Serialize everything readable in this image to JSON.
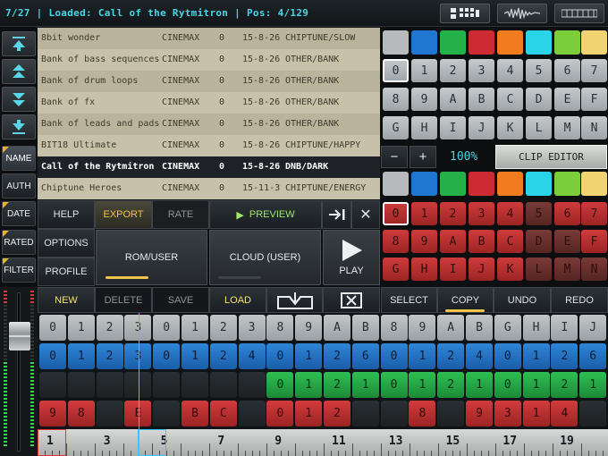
{
  "status": "7/27 | Loaded: Call of the Rytmitron | Pos: 4/129",
  "top_buttons": [
    "pattern-matrix-icon",
    "waveform-icon",
    "keyboard-icon"
  ],
  "sidebar": {
    "nav": [
      "scroll-top-icon",
      "page-up-icon",
      "page-down-icon",
      "scroll-bottom-icon"
    ],
    "sort": [
      "NAME",
      "AUTH",
      "DATE",
      "RATED",
      "FILTER"
    ]
  },
  "songs": [
    {
      "name": "8bit wonder",
      "author": "CINEMAX",
      "rating": "0",
      "date": "15-8-26",
      "genre": "CHIPTUNE/SLOW"
    },
    {
      "name": "Bank of bass sequences",
      "author": "CINEMAX",
      "rating": "0",
      "date": "15-8-26",
      "genre": "OTHER/BANK"
    },
    {
      "name": "Bank of drum loops",
      "author": "CINEMAX",
      "rating": "0",
      "date": "15-8-26",
      "genre": "OTHER/BANK"
    },
    {
      "name": "Bank of fx",
      "author": "CINEMAX",
      "rating": "0",
      "date": "15-8-26",
      "genre": "OTHER/BANK"
    },
    {
      "name": "Bank of leads and pads",
      "author": "CINEMAX",
      "rating": "0",
      "date": "15-8-26",
      "genre": "OTHER/BANK"
    },
    {
      "name": "BIT18 Ultimate",
      "author": "CINEMAX",
      "rating": "0",
      "date": "15-8-26",
      "genre": "CHIPTUNE/HAPPY"
    },
    {
      "name": "Call of the Rytmitron",
      "author": "CINEMAX",
      "rating": "0",
      "date": "15-8-26",
      "genre": "DNB/DARK"
    },
    {
      "name": "Chiptune Heroes",
      "author": "CINEMAX",
      "rating": "0",
      "date": "15-11-3",
      "genre": "CHIPTUNE/ENERGY"
    }
  ],
  "selected_song": 6,
  "controls": {
    "help": "HELP",
    "export": "EXPORT",
    "rate": "RATE",
    "preview": "PREVIEW",
    "options": "OPTIONS",
    "profile": "PROFILE",
    "rom_user": "ROM/USER",
    "cloud_user": "CLOUD (USER)",
    "play": "PLAY",
    "new": "NEW",
    "delete": "DELETE",
    "save": "SAVE",
    "load": "LOAD"
  },
  "edit_buttons": [
    "SELECT",
    "COPY",
    "UNDO",
    "REDO"
  ],
  "colors": {
    "swatches": [
      "#b6babd",
      "#1f77d2",
      "#24b14a",
      "#cc2b34",
      "#f07c1e",
      "#29d4e8",
      "#7ccd3a",
      "#f1d471"
    ],
    "cyan": "#49d6e6",
    "gold": "#f0c34a"
  },
  "pattern_pads": [
    "0",
    "1",
    "2",
    "3",
    "4",
    "5",
    "6",
    "7",
    "8",
    "9",
    "A",
    "B",
    "C",
    "D",
    "E",
    "F",
    "G",
    "H",
    "I",
    "J",
    "K",
    "L",
    "M",
    "N"
  ],
  "zoom": "100%",
  "clip_editor": "CLIP EDITOR",
  "minus": "−",
  "plus": "+",
  "clip_pads": [
    "0",
    "1",
    "2",
    "3",
    "4",
    "5",
    "6",
    "7",
    "8",
    "9",
    "A",
    "B",
    "C",
    "D",
    "E",
    "F",
    "G",
    "H",
    "I",
    "J",
    "K",
    "L",
    "M",
    "N"
  ],
  "sequencer_tracks": [
    {
      "color": "g",
      "cells": [
        "0",
        "1",
        "2",
        "3",
        "0",
        "1",
        "2",
        "3",
        "8",
        "9",
        "A",
        "B",
        "8",
        "9",
        "A",
        "B",
        "G",
        "H",
        "I",
        "J"
      ]
    },
    {
      "color": "b",
      "cells": [
        "0",
        "1",
        "2",
        "3",
        "0",
        "1",
        "2",
        "4",
        "0",
        "1",
        "2",
        "6",
        "0",
        "1",
        "2",
        "4",
        "0",
        "1",
        "2",
        "6"
      ]
    },
    {
      "color": "gr",
      "cells": [
        "",
        "",
        "",
        "",
        "",
        "",
        "",
        "",
        "0",
        "1",
        "2",
        "1",
        "0",
        "1",
        "2",
        "1",
        "0",
        "1",
        "2",
        "1"
      ]
    },
    {
      "color": "r",
      "cells": [
        "9",
        "8",
        "",
        "E",
        "",
        "B",
        "C",
        "",
        "0",
        "1",
        "2",
        "",
        "",
        "8",
        "",
        "9",
        "3",
        "1",
        "4",
        ""
      ]
    }
  ],
  "ruler": [
    "1",
    "3",
    "5",
    "7",
    "9",
    "11",
    "13",
    "15",
    "17",
    "19"
  ]
}
